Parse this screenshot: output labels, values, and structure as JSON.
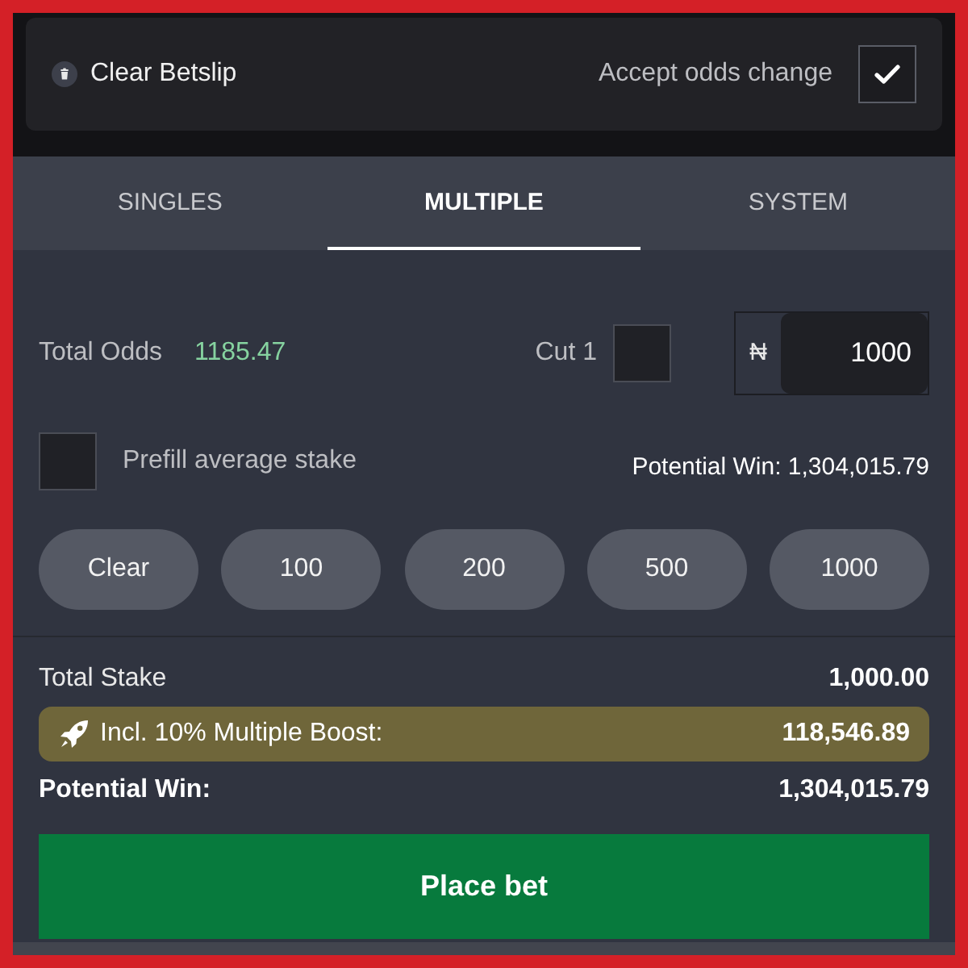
{
  "header": {
    "clear_label": "Clear Betslip",
    "accept_odds": {
      "label": "Accept odds change",
      "checked": true
    }
  },
  "tabs": [
    {
      "label": "SINGLES",
      "selected": false
    },
    {
      "label": "MULTIPLE",
      "selected": true
    },
    {
      "label": "SYSTEM",
      "selected": false
    }
  ],
  "total_odds": {
    "label": "Total Odds",
    "value": "1185.47"
  },
  "cut": {
    "label": "Cut 1",
    "checked": false
  },
  "stake_field": {
    "currency": "₦",
    "value": "1000"
  },
  "prefill": {
    "label": "Prefill average stake",
    "checked": false
  },
  "potential_win_preview": "Potential Win: 1,304,015.79",
  "stake_buttons": [
    "Clear",
    "100",
    "200",
    "500",
    "1000"
  ],
  "summary": {
    "total_stake": {
      "label": "Total Stake",
      "value": "1,000.00"
    },
    "boost": {
      "label": "Incl. 10% Multiple Boost:",
      "value": "118,546.89"
    },
    "potential_win": {
      "label": "Potential Win:",
      "value": "1,304,015.79"
    }
  },
  "place_bet": "Place bet"
}
